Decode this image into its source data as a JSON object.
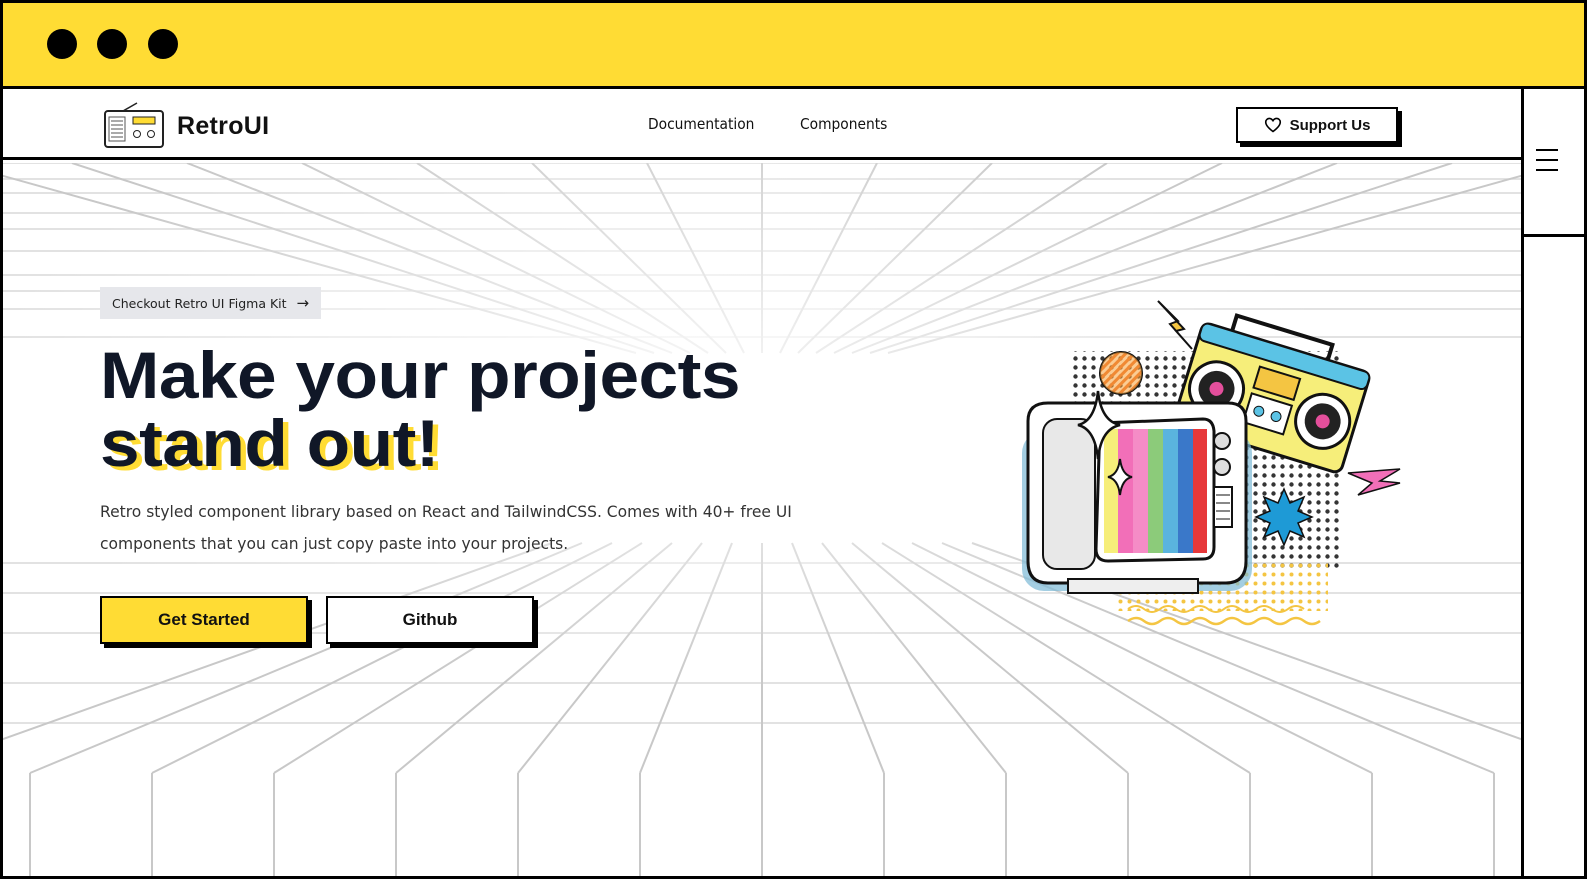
{
  "brand": {
    "name": "RetroUI",
    "accent": "#FFDC34",
    "dark": "#101727"
  },
  "nav": {
    "links": [
      {
        "label": "Documentation"
      },
      {
        "label": "Components"
      }
    ],
    "support_label": "Support Us"
  },
  "hero": {
    "pill_label": "Checkout Retro UI Figma Kit",
    "headline_line1": "Make your projects",
    "headline_line2": "stand out!",
    "subtitle": "Retro styled component library based on React and TailwindCSS. Comes with 40+ free UI components that you can just copy paste into your projects.",
    "primary_button": "Get Started",
    "secondary_button": "Github"
  },
  "icons": {
    "window_dots": [
      "dot-icon",
      "dot-icon",
      "dot-icon"
    ],
    "logo": "radio-icon",
    "support": "heart-icon",
    "pill_arrow": "arrow-right-icon",
    "menu": "hamburger-menu-icon",
    "illustration": "retro-tv-boombox-illustration"
  }
}
